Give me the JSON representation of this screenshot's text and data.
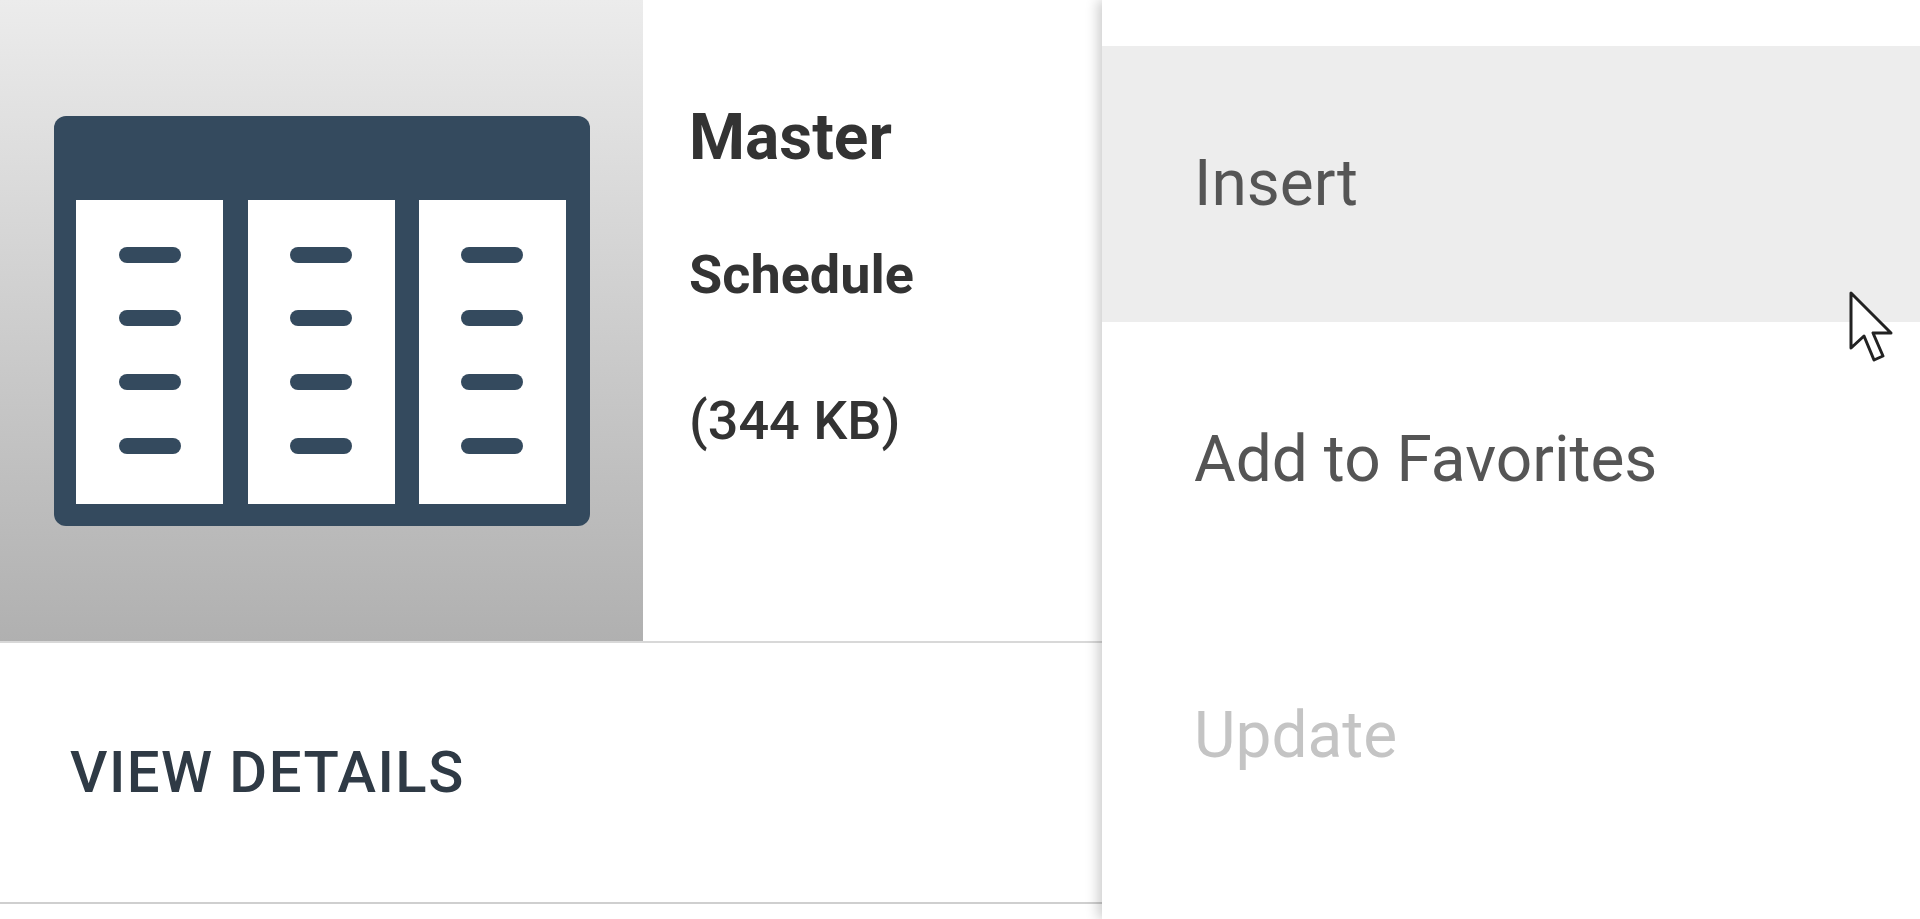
{
  "card": {
    "title_lines": [
      "Master",
      "Schedule"
    ],
    "size": "(344 KB)",
    "action": "VIEW DETAILS"
  },
  "menu": {
    "items": [
      {
        "label": "Insert",
        "selected": true,
        "disabled": false
      },
      {
        "label": "Add to Favorites",
        "selected": false,
        "disabled": false
      },
      {
        "label": "Update",
        "selected": false,
        "disabled": true
      }
    ]
  }
}
